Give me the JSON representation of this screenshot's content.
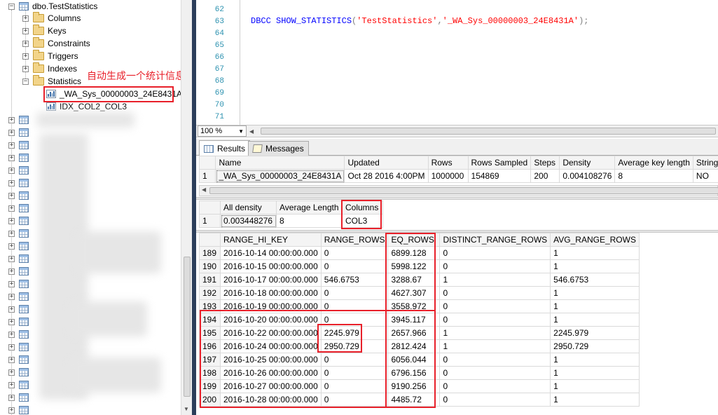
{
  "object_explorer": {
    "table_name": "dbo.TestStatistics",
    "folders": [
      "Columns",
      "Keys",
      "Constraints",
      "Triggers",
      "Indexes",
      "Statistics"
    ],
    "statistics": [
      "_WA_Sys_00000003_24E8431A",
      "IDX_COL2_COL3"
    ],
    "annotation": "自动生成一个统计信息"
  },
  "editor": {
    "line_numbers": [
      "62",
      "63",
      "64",
      "65",
      "66",
      "67",
      "68",
      "69",
      "70",
      "71"
    ],
    "code": {
      "keyword": "DBCC SHOW_STATISTICS",
      "open": "(",
      "arg1": "'TestStatistics'",
      "comma": ",",
      "arg2": "'_WA_Sys_00000003_24E8431A'",
      "close": ");"
    },
    "zoom": "100 %"
  },
  "result_tabs": [
    "Results",
    "Messages"
  ],
  "header_grid": {
    "columns": [
      "Name",
      "Updated",
      "Rows",
      "Rows Sampled",
      "Steps",
      "Density",
      "Average key length",
      "String I"
    ],
    "row": [
      "1",
      "_WA_Sys_00000003_24E8431A",
      "Oct 28 2016  4:00PM",
      "1000000",
      "154869",
      "200",
      "0.004108276",
      "8",
      "NO"
    ]
  },
  "density_grid": {
    "columns": [
      "All density",
      "Average Length",
      "Columns"
    ],
    "row": [
      "1",
      "0.003448276",
      "8",
      "COL3"
    ]
  },
  "histogram_grid": {
    "columns": [
      "RANGE_HI_KEY",
      "RANGE_ROWS",
      "EQ_ROWS",
      "DISTINCT_RANGE_ROWS",
      "AVG_RANGE_ROWS"
    ],
    "rows": [
      [
        "189",
        "2016-10-14 00:00:00.000",
        "0",
        "6899.128",
        "0",
        "1"
      ],
      [
        "190",
        "2016-10-15 00:00:00.000",
        "0",
        "5998.122",
        "0",
        "1"
      ],
      [
        "191",
        "2016-10-17 00:00:00.000",
        "546.6753",
        "3288.67",
        "1",
        "546.6753"
      ],
      [
        "192",
        "2016-10-18 00:00:00.000",
        "0",
        "4627.307",
        "0",
        "1"
      ],
      [
        "193",
        "2016-10-19 00:00:00.000",
        "0",
        "3558.972",
        "0",
        "1"
      ],
      [
        "194",
        "2016-10-20 00:00:00.000",
        "0",
        "3945.117",
        "0",
        "1"
      ],
      [
        "195",
        "2016-10-22 00:00:00.000",
        "2245.979",
        "2657.966",
        "1",
        "2245.979"
      ],
      [
        "196",
        "2016-10-24 00:00:00.000",
        "2950.729",
        "2812.424",
        "1",
        "2950.729"
      ],
      [
        "197",
        "2016-10-25 00:00:00.000",
        "0",
        "6056.044",
        "0",
        "1"
      ],
      [
        "198",
        "2016-10-26 00:00:00.000",
        "0",
        "6796.156",
        "0",
        "1"
      ],
      [
        "199",
        "2016-10-27 00:00:00.000",
        "0",
        "9190.256",
        "0",
        "1"
      ],
      [
        "200",
        "2016-10-28 00:00:00.000",
        "0",
        "4485.72",
        "0",
        "1"
      ]
    ]
  },
  "colors": {
    "highlight": "#e8202a",
    "keyword": "#0000ff",
    "string": "#ff0000",
    "line_number": "#2b91af"
  }
}
